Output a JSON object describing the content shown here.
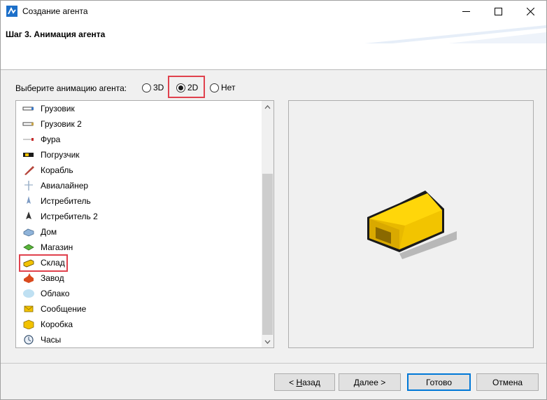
{
  "window": {
    "title": "Создание агента"
  },
  "header": {
    "step_title": "Шаг 3. Анимация агента"
  },
  "animation": {
    "label": "Выберите анимацию агента:",
    "options": [
      {
        "label": "3D",
        "selected": false
      },
      {
        "label": "2D",
        "selected": true
      },
      {
        "label": "Нет",
        "selected": false
      }
    ]
  },
  "list": {
    "selected": "Склад",
    "items": [
      {
        "label": "Грузовик",
        "icon": "truck-icon"
      },
      {
        "label": "Грузовик 2",
        "icon": "truck2-icon"
      },
      {
        "label": "Фура",
        "icon": "semi-truck-icon"
      },
      {
        "label": "Погрузчик",
        "icon": "forklift-icon"
      },
      {
        "label": "Корабль",
        "icon": "ship-icon"
      },
      {
        "label": "Авиалайнер",
        "icon": "airliner-icon"
      },
      {
        "label": "Истребитель",
        "icon": "fighter-icon"
      },
      {
        "label": "Истребитель 2",
        "icon": "fighter2-icon"
      },
      {
        "label": "Дом",
        "icon": "house-icon"
      },
      {
        "label": "Магазин",
        "icon": "shop-icon"
      },
      {
        "label": "Склад",
        "icon": "warehouse-icon"
      },
      {
        "label": "Завод",
        "icon": "factory-icon"
      },
      {
        "label": "Облако",
        "icon": "cloud-icon"
      },
      {
        "label": "Сообщение",
        "icon": "message-icon"
      },
      {
        "label": "Коробка",
        "icon": "box-icon"
      },
      {
        "label": "Часы",
        "icon": "clock-icon"
      }
    ]
  },
  "buttons": {
    "back_prefix": "< ",
    "back_mnemonic": "Н",
    "back_rest": "азад",
    "next": "Далее >",
    "done": "Готово",
    "cancel": "Отмена"
  },
  "colors": {
    "accent": "#0078d7",
    "highlight": "#e0414d",
    "warehouse": "#f2c200"
  }
}
